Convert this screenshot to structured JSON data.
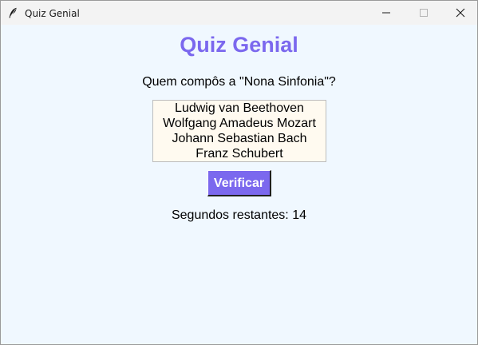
{
  "window": {
    "title": "Quiz Genial",
    "icon": "feather-icon",
    "controls": [
      "minimize-icon",
      "maximize-icon",
      "close-icon"
    ]
  },
  "quiz": {
    "title": "Quiz Genial",
    "question": "Quem compôs a \"Nona Sinfonia\"?",
    "options": [
      "Ludwig van Beethoven",
      "Wolfgang Amadeus Mozart",
      "Johann Sebastian Bach",
      "Franz Schubert"
    ],
    "verify_label": "Verificar",
    "timer_text": "Segundos restantes: 14"
  },
  "colors": {
    "accent": "#7b68ee",
    "background": "#f0f8ff",
    "listbox_background": "#fffaf0"
  }
}
